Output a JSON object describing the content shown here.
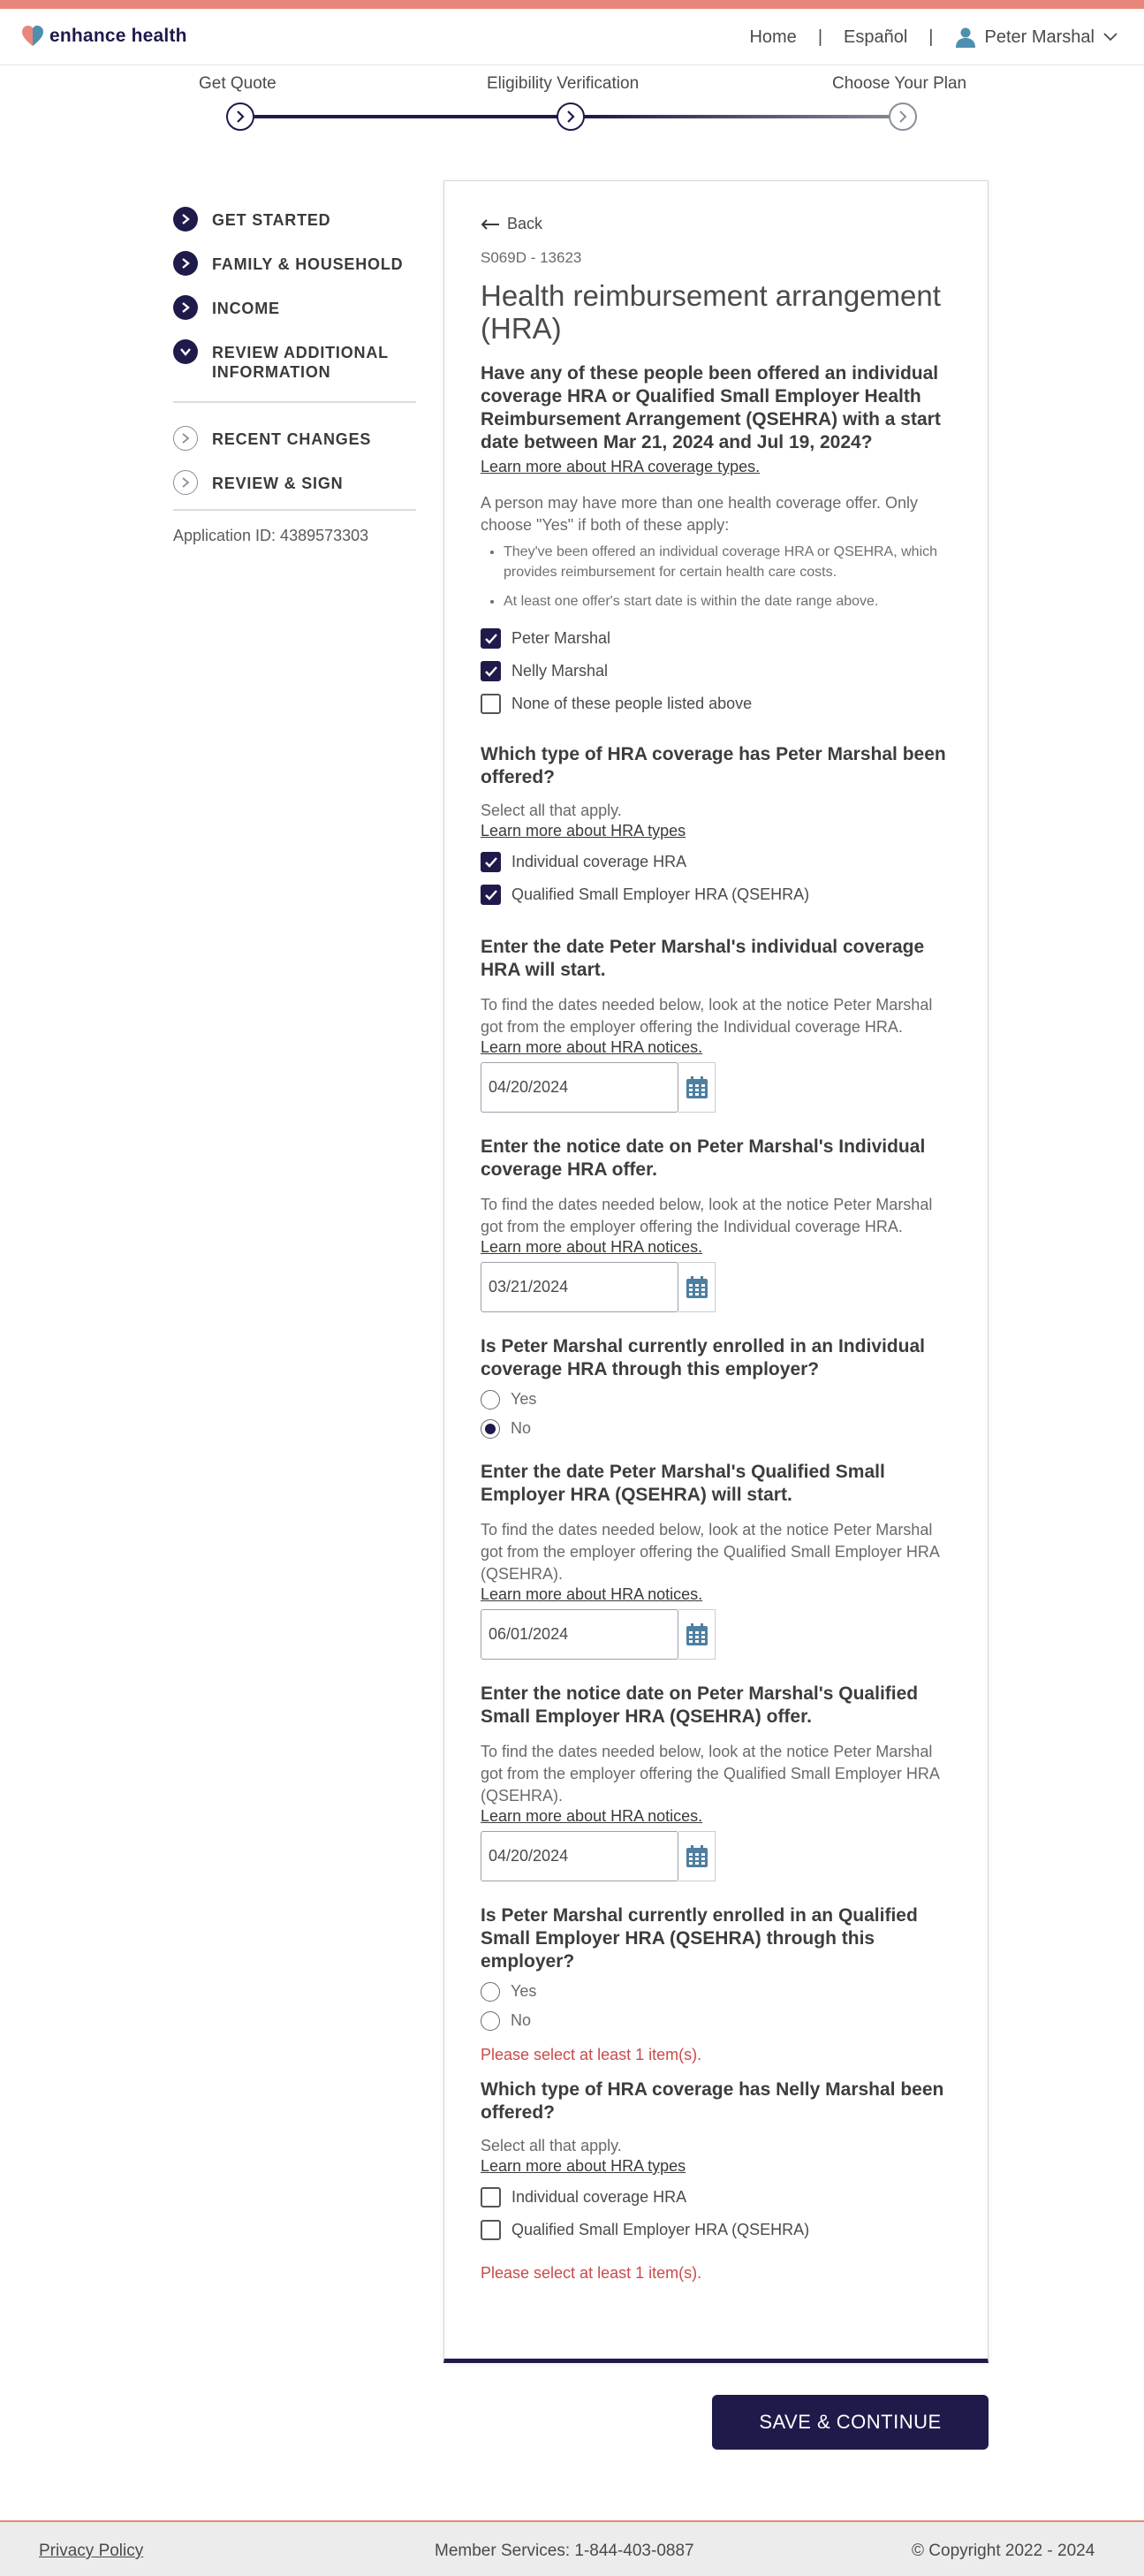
{
  "header": {
    "brand": "enhance health",
    "nav": {
      "home": "Home",
      "separator": "|",
      "language": "Español",
      "user_name": "Peter Marshal"
    }
  },
  "stepper": {
    "steps": [
      {
        "label": "Get Quote",
        "state": "complete"
      },
      {
        "label": "Eligibility Verification",
        "state": "current"
      },
      {
        "label": "Choose Your Plan",
        "state": "upcoming"
      }
    ]
  },
  "sidebar": {
    "items": [
      {
        "label": "GET STARTED",
        "icon": "chevron-right-icon",
        "state": "complete"
      },
      {
        "label": "FAMILY & HOUSEHOLD",
        "icon": "chevron-right-icon",
        "state": "complete"
      },
      {
        "label": "INCOME",
        "icon": "chevron-right-icon",
        "state": "complete"
      },
      {
        "label": "REVIEW ADDITIONAL INFORMATION",
        "icon": "chevron-down-icon",
        "state": "current"
      },
      {
        "label": "RECENT CHANGES",
        "icon": "chevron-right-icon",
        "state": "upcoming"
      },
      {
        "label": "REVIEW & SIGN",
        "icon": "chevron-right-icon",
        "state": "upcoming"
      }
    ],
    "application_id": "Application ID: 4389573303"
  },
  "form": {
    "back": "Back",
    "code": "S069D - 13623",
    "title": "Health reimbursement arrangement (HRA)",
    "q1": {
      "question": "Have any of these people been offered an individual coverage HRA or Qualified Small Employer Health Reimbursement Arrangement (QSEHRA) with a start date between Mar 21, 2024 and Jul 19, 2024?",
      "link": "Learn more about HRA coverage types.",
      "intro": "A person may have more than one health coverage offer. Only choose \"Yes\" if both of these apply:",
      "bullets": [
        "They've been offered an individual coverage HRA or QSEHRA, which provides reimbursement for certain health care costs.",
        "At least one offer's start date is within the date range above."
      ],
      "options": [
        {
          "label": "Peter Marshal",
          "checked": true
        },
        {
          "label": "Nelly Marshal",
          "checked": true
        },
        {
          "label": "None of these people listed above",
          "checked": false
        }
      ]
    },
    "q2": {
      "question": "Which type of HRA coverage has Peter Marshal been offered?",
      "hint": "Select all that apply.",
      "link": "Learn more about HRA types",
      "options": [
        {
          "label": "Individual coverage HRA",
          "checked": true
        },
        {
          "label": "Qualified Small Employer HRA (QSEHRA)",
          "checked": true
        }
      ]
    },
    "q3": {
      "question": "Enter the date Peter Marshal's individual coverage HRA will start.",
      "hint": "To find the dates needed below, look at the notice Peter Marshal got from the employer offering the Individual coverage HRA.",
      "link": "Learn more about HRA notices.",
      "value": "04/20/2024"
    },
    "q4": {
      "question": "Enter the notice date on Peter Marshal's Individual coverage HRA offer.",
      "hint": "To find the dates needed below, look at the notice Peter Marshal got from the employer offering the Individual coverage HRA.",
      "link": "Learn more about HRA notices.",
      "value": "03/21/2024"
    },
    "q5": {
      "question": "Is Peter Marshal currently enrolled in an Individual coverage HRA through this employer?",
      "options": [
        {
          "label": "Yes",
          "selected": false
        },
        {
          "label": "No",
          "selected": true
        }
      ]
    },
    "q6": {
      "question": "Enter the date Peter Marshal's Qualified Small Employer HRA (QSEHRA) will start.",
      "hint": "To find the dates needed below, look at the notice Peter Marshal got from the employer offering the Qualified Small Employer HRA (QSEHRA).",
      "link": "Learn more about HRA notices.",
      "value": "06/01/2024"
    },
    "q7": {
      "question": "Enter the notice date on Peter Marshal's Qualified Small Employer HRA (QSEHRA) offer.",
      "hint": "To find the dates needed below, look at the notice Peter Marshal got from the employer offering the Qualified Small Employer HRA (QSEHRA).",
      "link": "Learn more about HRA notices.",
      "value": "04/20/2024"
    },
    "q8": {
      "question": "Is Peter Marshal currently enrolled in an Qualified Small Employer HRA (QSEHRA) through this employer?",
      "options": [
        {
          "label": "Yes",
          "selected": false
        },
        {
          "label": "No",
          "selected": false
        }
      ],
      "error": "Please select at least 1 item(s)."
    },
    "q9": {
      "question": "Which type of HRA coverage has Nelly Marshal been offered?",
      "hint": "Select all that apply.",
      "link": "Learn more about HRA types",
      "options": [
        {
          "label": "Individual coverage HRA",
          "checked": false
        },
        {
          "label": "Qualified Small Employer HRA (QSEHRA)",
          "checked": false
        }
      ],
      "error": "Please select at least 1 item(s)."
    },
    "save": "SAVE & CONTINUE"
  },
  "footer": {
    "privacy": "Privacy Policy",
    "member_services": "Member Services: 1-844-403-0887",
    "copyright": "© Copyright 2022 - 2024"
  },
  "colors": {
    "navy": "#1e1b4b",
    "accent": "#e9867a",
    "error": "#c94a4a"
  }
}
